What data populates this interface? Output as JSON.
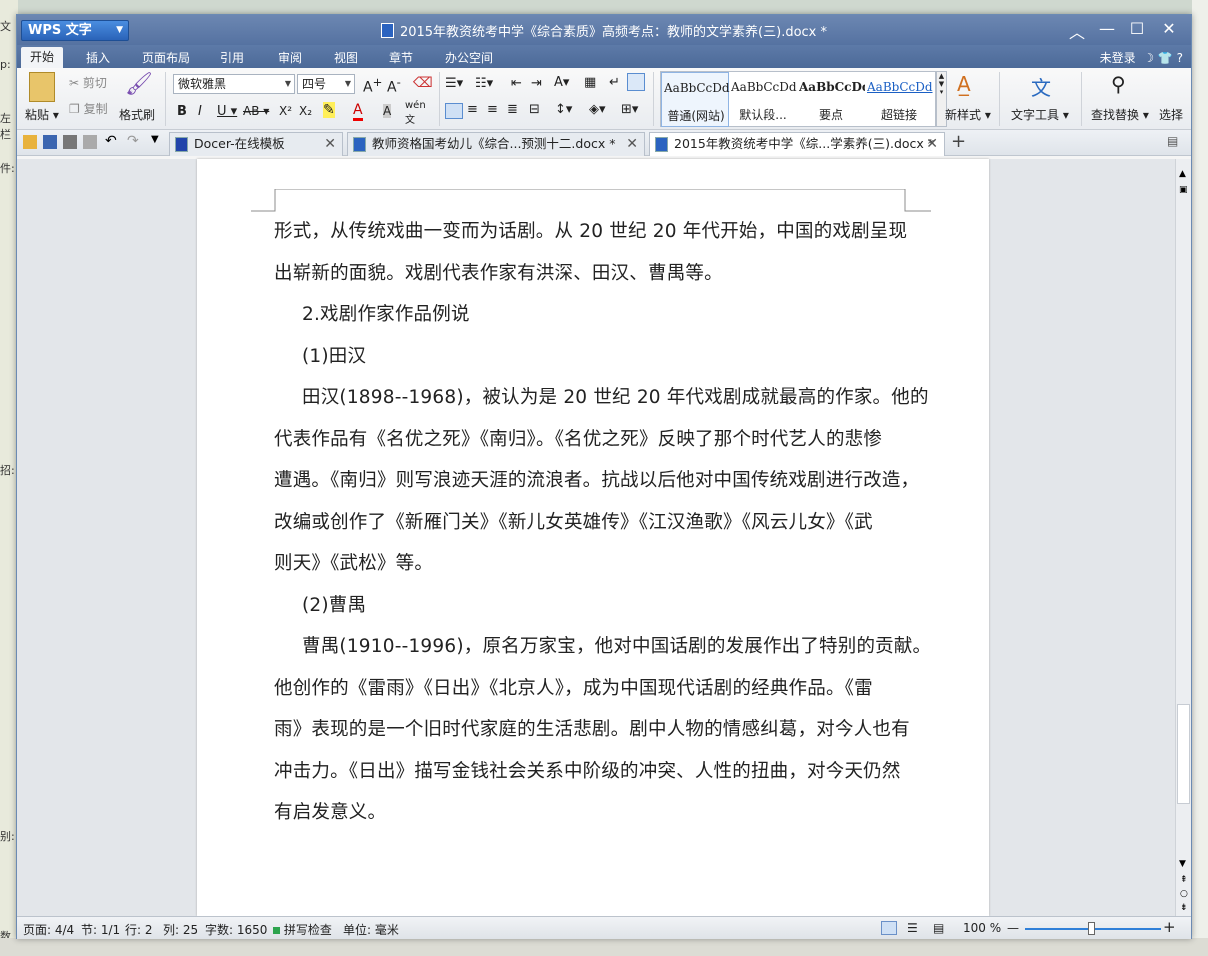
{
  "background": {
    "left_snippets": [
      "文",
      "p:",
      "左栏",
      "件:",
      "招:",
      "别:",
      "数"
    ]
  },
  "window": {
    "app_button_label": "WPS 文字",
    "title": "2015年教资统考中学《综合素质》高频考点：教师的文学素养(三).docx *"
  },
  "menubar": {
    "tabs": [
      "开始",
      "插入",
      "页面布局",
      "引用",
      "审阅",
      "视图",
      "章节",
      "办公空间"
    ],
    "active_tab": "开始",
    "login": "未登录"
  },
  "ribbon": {
    "paste": "粘贴",
    "cut": "剪切",
    "copy": "复制",
    "format_painter": "格式刷",
    "font_name": "微软雅黑",
    "font_size": "四号",
    "styles": [
      {
        "sample": "AaBbCcDd",
        "name": "普通(网站)"
      },
      {
        "sample": "AaBbCcDd",
        "name": "默认段..."
      },
      {
        "sample": "AaBbCcDd",
        "name": "要点"
      },
      {
        "sample": "AaBbCcDd",
        "name": "超链接"
      }
    ],
    "new_style": "新样式",
    "text_tools": "文字工具",
    "find_replace": "查找替换",
    "select": "选择"
  },
  "tabs": [
    {
      "label": "Docer-在线模板",
      "active": false
    },
    {
      "label": "教师资格国考幼儿《综合...预测十二.docx *",
      "active": false
    },
    {
      "label": "2015年教资统考中学《综...学素养(三).docx *",
      "active": true
    }
  ],
  "document": {
    "paragraphs": [
      {
        "text": "形式，从传统戏曲一变而为话剧。从 20 世纪 20 年代开始，中国的戏剧呈现",
        "indent": false
      },
      {
        "text": "出崭新的面貌。戏剧代表作家有洪深、田汉、曹禺等。",
        "indent": false
      },
      {
        "text": "2.戏剧作家作品例说",
        "indent": true
      },
      {
        "text": "(1)田汉",
        "indent": true
      },
      {
        "text": "田汉(1898--1968)，被认为是 20 世纪 20 年代戏剧成就最高的作家。他的",
        "indent": true
      },
      {
        "text": "代表作品有《名优之死》《南归》。《名优之死》反映了那个时代艺人的悲惨",
        "indent": false
      },
      {
        "text": "遭遇。《南归》则写浪迹天涯的流浪者。抗战以后他对中国传统戏剧进行改造，",
        "indent": false
      },
      {
        "text": "改编或创作了《新雁门关》《新儿女英雄传》《江汉渔歌》《风云儿女》《武",
        "indent": false
      },
      {
        "text": "则天》《武松》等。",
        "indent": false
      },
      {
        "text": "(2)曹禺",
        "indent": true
      },
      {
        "text": "曹禺(1910--1996)，原名万家宝，他对中国话剧的发展作出了特别的贡献。",
        "indent": true
      },
      {
        "text": "他创作的《雷雨》《日出》《北京人》，成为中国现代话剧的经典作品。《雷",
        "indent": false
      },
      {
        "text": "雨》表现的是一个旧时代家庭的生活悲剧。剧中人物的情感纠葛，对今人也有",
        "indent": false
      },
      {
        "text": "冲击力。《日出》描写金钱社会关系中阶级的冲突、人性的扭曲，对今天仍然",
        "indent": false
      },
      {
        "text": "有启发意义。",
        "indent": false
      }
    ]
  },
  "statusbar": {
    "page": "页面: 4/4",
    "section": "节: 1/1",
    "row": "行: 2",
    "col": "列: 25",
    "word_count": "字数: 1650",
    "spell_check": "拼写检查",
    "unit": "单位: 毫米",
    "zoom": "100 %"
  }
}
